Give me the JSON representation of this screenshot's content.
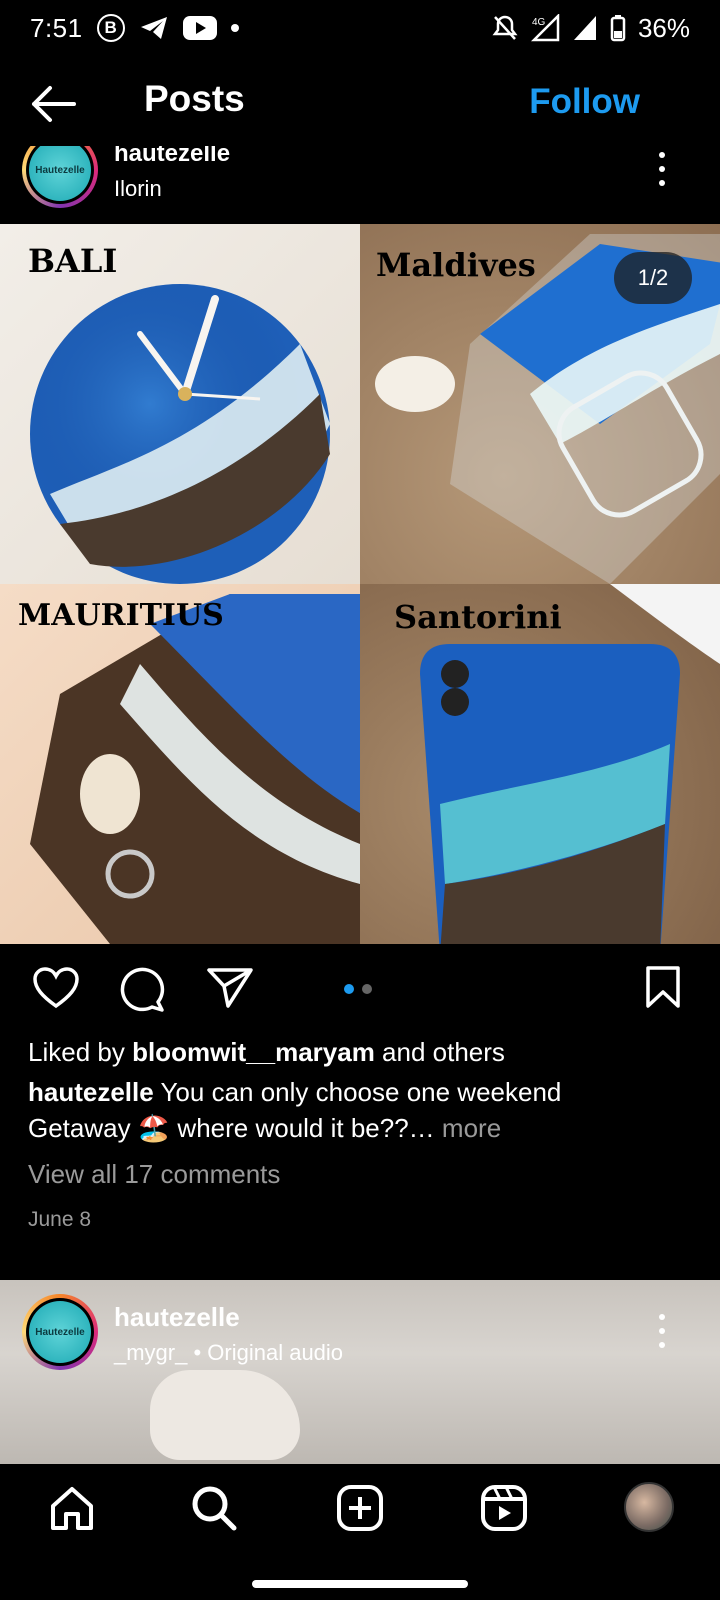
{
  "status": {
    "time": "7:51",
    "left_icons": [
      "b-circle-icon",
      "telegram-icon",
      "youtube-icon",
      "notification-dot-icon"
    ],
    "network": "4G",
    "battery": "36%"
  },
  "header": {
    "title": "Posts",
    "follow_label": "Follow"
  },
  "post1": {
    "username": "hautezelle",
    "location": "Ilorin",
    "avatar_text": "Hautezelle",
    "image_counter": "1/2",
    "tiles": [
      {
        "label": "BALI"
      },
      {
        "label": "Maldives"
      },
      {
        "label": "MAURITIUS"
      },
      {
        "label": "Santorini"
      }
    ],
    "liked_by_prefix": "Liked by ",
    "liked_by_user": "bloomwit__maryam",
    "liked_by_suffix": " and others",
    "caption_user": "hautezelle",
    "caption_text": " You can only choose one weekend Getaway 🏖️ where would it be??…",
    "caption_more": " more",
    "view_comments": "View all 17 comments",
    "date": "June 8"
  },
  "post2": {
    "username": "hautezelle",
    "audio": "_mygr_ • Original audio",
    "avatar_text": "Hautezelle"
  },
  "colors": {
    "accent": "#1d9bf0",
    "background": "#000000",
    "muted": "#9a9a9a"
  }
}
